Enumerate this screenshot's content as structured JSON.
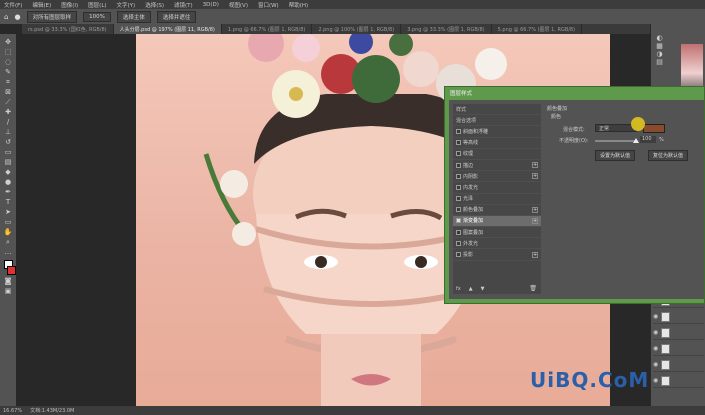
{
  "menubar": {
    "items": [
      "文件(F)",
      "编辑(E)",
      "图像(I)",
      "图层(L)",
      "文字(Y)",
      "选择(S)",
      "滤镜(T)",
      "3D(D)",
      "视图(V)",
      "窗口(W)",
      "帮助(H)"
    ]
  },
  "options": {
    "sample_all_label": "对所有图层取样",
    "size_value": "100%",
    "btn_a": "选择主体",
    "btn_b": "选择并遮住"
  },
  "tabs": [
    {
      "label": "rs.psd @ 33.3% (国红色, RGB/8)",
      "active": false
    },
    {
      "label": "人头分层.psd @ 197% (图层 11, RGB/8)",
      "active": true
    },
    {
      "label": "1.png @ 66.7% (图层 1, RGB/8)",
      "active": false
    },
    {
      "label": "2.png @ 100% (图层 1, RGB/8)",
      "active": false
    },
    {
      "label": "3.png @ 33.3% (图层 1, RGB/8)",
      "active": false
    },
    {
      "label": "5.png @ 66.7% (图层 1, RGB/8)",
      "active": false
    }
  ],
  "dialog": {
    "title": "图层样式",
    "list_header": "样式",
    "blend_header": "混合选项",
    "items": [
      {
        "label": "斜面和浮雕",
        "checked": false,
        "plus": false
      },
      {
        "label": "等高线",
        "checked": false,
        "plus": false
      },
      {
        "label": "纹理",
        "checked": false,
        "plus": false
      },
      {
        "label": "描边",
        "checked": false,
        "plus": true
      },
      {
        "label": "内阴影",
        "checked": false,
        "plus": true
      },
      {
        "label": "内发光",
        "checked": false,
        "plus": false
      },
      {
        "label": "光泽",
        "checked": false,
        "plus": false
      },
      {
        "label": "颜色叠加",
        "checked": false,
        "plus": true
      },
      {
        "label": "渐变叠加",
        "checked": false,
        "plus": true
      },
      {
        "label": "图案叠加",
        "checked": false,
        "plus": false
      },
      {
        "label": "外发光",
        "checked": false,
        "plus": false
      },
      {
        "label": "投影",
        "checked": false,
        "plus": true
      }
    ],
    "selected_index": 8,
    "settings": {
      "section_title": "颜色叠加",
      "sub_title": "颜色",
      "blend_mode_label": "混合模式:",
      "blend_mode_value": "正常",
      "opacity_label": "不透明度(O):",
      "opacity_value": "100",
      "opacity_unit": "%",
      "btn_default": "设置为默认值",
      "btn_reset": "复位为默认值",
      "swatch_color": "#8a4a2c"
    },
    "footer_fx": "fx"
  },
  "status": {
    "zoom": "16.67%",
    "doc": "文档:1.43M/23.0M"
  },
  "watermark": "UiBQ.CoM",
  "colors": {
    "accent_green": "#5f9a4c",
    "yellow_cursor": "#d8c020"
  }
}
